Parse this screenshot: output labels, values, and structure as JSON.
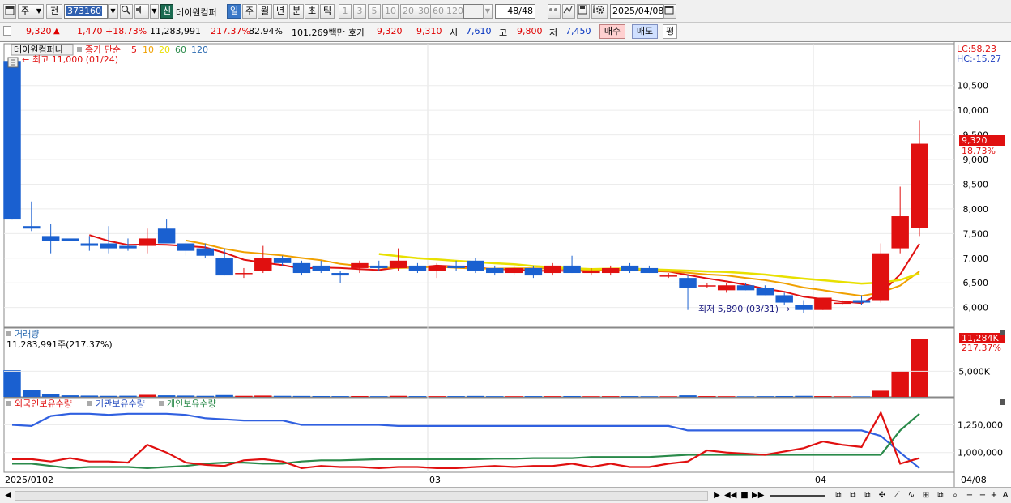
{
  "toolbar": {
    "period_select": "주",
    "prev_label": "전",
    "stock_code": "373160",
    "tag_label": "신",
    "stock_name": "데이원컴퍼",
    "periods": [
      "일",
      "주",
      "월",
      "년",
      "분",
      "초",
      "틱"
    ],
    "active_period": "일",
    "intervals": [
      "1",
      "3",
      "5",
      "10",
      "20",
      "30",
      "60",
      "120"
    ],
    "count": "48",
    "count_total": "/48",
    "date": "2025/04/08"
  },
  "quote": {
    "price": "9,320",
    "change": "1,470",
    "change_pct": "+18.73%",
    "volume": "11,283,991",
    "volume_pct": "217.37%",
    "rate": "82.94%",
    "amount": "101,269백만",
    "hoga_label": "호가",
    "ask": "9,320",
    "bid": "9,310",
    "open_label": "시",
    "open": "7,610",
    "high_label": "고",
    "high": "9,800",
    "low_label": "저",
    "low": "7,450",
    "buy_label": "매수",
    "sell_label": "매도",
    "flat_label": "평"
  },
  "price_pane": {
    "stock_title": "데이원컴퍼니",
    "indicator_name": "종가 단순",
    "ma_labels": [
      "5",
      "10",
      "20",
      "60",
      "120"
    ],
    "ma_colors": [
      "#e01010",
      "#f0a000",
      "#e8e000",
      "#2a8a4a",
      "#2a6ab0"
    ],
    "high_annotation": "최고 11,000 (01/24)",
    "low_annotation": "최저 5,890 (03/31)",
    "lc_label": "LC:58.23",
    "hc_label": "HC:-15.27",
    "current_price_tag": "9,320",
    "current_pct_tag": "18.73%"
  },
  "volume_pane": {
    "title": "거래량",
    "value": "11,283,991주(217.37%)",
    "tag": "11,284K",
    "tag_pct": "217.37%"
  },
  "holding_pane": {
    "series_names": [
      "외국인보유수량",
      "기관보유수량",
      "개인보유수량"
    ]
  },
  "x_axis": {
    "labels": [
      "2025/01",
      "02",
      "03",
      "04"
    ],
    "right_label": "04/08"
  },
  "chart_data": {
    "type": "candlestick",
    "price_axis": {
      "min": 5600,
      "max": 11300,
      "ticks": [
        6000,
        6500,
        7000,
        7500,
        8000,
        8500,
        9000,
        9500,
        10000,
        10500
      ],
      "tick_labels": [
        "6,000",
        "6,500",
        "7,000",
        "7,500",
        "8,000",
        "8,500",
        "9,000",
        "9,500",
        "10,000",
        "10,500"
      ]
    },
    "candles": [
      {
        "o": 11000,
        "h": 11000,
        "l": 7800,
        "c": 7800
      },
      {
        "o": 7650,
        "h": 8150,
        "l": 7550,
        "c": 7600
      },
      {
        "o": 7450,
        "h": 7700,
        "l": 7100,
        "c": 7350
      },
      {
        "o": 7400,
        "h": 7600,
        "l": 7250,
        "c": 7350
      },
      {
        "o": 7300,
        "h": 7450,
        "l": 7150,
        "c": 7250
      },
      {
        "o": 7300,
        "h": 7650,
        "l": 7100,
        "c": 7200
      },
      {
        "o": 7250,
        "h": 7400,
        "l": 7150,
        "c": 7200
      },
      {
        "o": 7250,
        "h": 7600,
        "l": 7100,
        "c": 7400
      },
      {
        "o": 7600,
        "h": 7800,
        "l": 7300,
        "c": 7300
      },
      {
        "o": 7300,
        "h": 7350,
        "l": 7050,
        "c": 7150
      },
      {
        "o": 7200,
        "h": 7300,
        "l": 7000,
        "c": 7050
      },
      {
        "o": 7000,
        "h": 7200,
        "l": 6650,
        "c": 6650
      },
      {
        "o": 6700,
        "h": 6800,
        "l": 6600,
        "c": 6700
      },
      {
        "o": 6750,
        "h": 7250,
        "l": 6700,
        "c": 7000
      },
      {
        "o": 7000,
        "h": 7050,
        "l": 6850,
        "c": 6900
      },
      {
        "o": 6900,
        "h": 6950,
        "l": 6650,
        "c": 6700
      },
      {
        "o": 6850,
        "h": 6950,
        "l": 6700,
        "c": 6750
      },
      {
        "o": 6700,
        "h": 6750,
        "l": 6500,
        "c": 6650
      },
      {
        "o": 6800,
        "h": 6950,
        "l": 6700,
        "c": 6900
      },
      {
        "o": 6850,
        "h": 6950,
        "l": 6750,
        "c": 6800
      },
      {
        "o": 6800,
        "h": 7200,
        "l": 6750,
        "c": 6950
      },
      {
        "o": 6850,
        "h": 6900,
        "l": 6700,
        "c": 6750
      },
      {
        "o": 6750,
        "h": 6900,
        "l": 6600,
        "c": 6850
      },
      {
        "o": 6850,
        "h": 6950,
        "l": 6750,
        "c": 6800
      },
      {
        "o": 6950,
        "h": 7000,
        "l": 6700,
        "c": 6750
      },
      {
        "o": 6800,
        "h": 6850,
        "l": 6650,
        "c": 6700
      },
      {
        "o": 6700,
        "h": 6850,
        "l": 6650,
        "c": 6800
      },
      {
        "o": 6800,
        "h": 6850,
        "l": 6600,
        "c": 6650
      },
      {
        "o": 6700,
        "h": 6900,
        "l": 6650,
        "c": 6850
      },
      {
        "o": 6850,
        "h": 7050,
        "l": 6700,
        "c": 6700
      },
      {
        "o": 6700,
        "h": 6800,
        "l": 6650,
        "c": 6750
      },
      {
        "o": 6700,
        "h": 6850,
        "l": 6650,
        "c": 6800
      },
      {
        "o": 6850,
        "h": 6900,
        "l": 6700,
        "c": 6750
      },
      {
        "o": 6800,
        "h": 6850,
        "l": 6700,
        "c": 6700
      },
      {
        "o": 6650,
        "h": 6700,
        "l": 6600,
        "c": 6650
      },
      {
        "o": 6600,
        "h": 6650,
        "l": 5950,
        "c": 6400
      },
      {
        "o": 6450,
        "h": 6500,
        "l": 6400,
        "c": 6450
      },
      {
        "o": 6350,
        "h": 6500,
        "l": 6300,
        "c": 6450
      },
      {
        "o": 6450,
        "h": 6500,
        "l": 6350,
        "c": 6350
      },
      {
        "o": 6400,
        "h": 6450,
        "l": 6250,
        "c": 6250
      },
      {
        "o": 6250,
        "h": 6300,
        "l": 6050,
        "c": 6100
      },
      {
        "o": 6050,
        "h": 6150,
        "l": 5890,
        "c": 5950
      },
      {
        "o": 5950,
        "h": 6200,
        "l": 5950,
        "c": 6200
      },
      {
        "o": 6100,
        "h": 6150,
        "l": 6050,
        "c": 6100
      },
      {
        "o": 6150,
        "h": 6250,
        "l": 6050,
        "c": 6100
      },
      {
        "o": 6150,
        "h": 7300,
        "l": 6100,
        "c": 7100
      },
      {
        "o": 7200,
        "h": 8450,
        "l": 7100,
        "c": 7850
      },
      {
        "o": 7610,
        "h": 9800,
        "l": 7450,
        "c": 9320
      }
    ],
    "volume_axis": {
      "ticks": [
        5000
      ],
      "tick_labels": [
        "5,000K"
      ],
      "max": 12000
    },
    "volume_k": [
      5200,
      1400,
      500,
      300,
      250,
      200,
      220,
      400,
      300,
      250,
      200,
      350,
      200,
      250,
      200,
      180,
      160,
      150,
      160,
      140,
      200,
      150,
      140,
      150,
      180,
      140,
      130,
      150,
      140,
      160,
      130,
      140,
      150,
      130,
      120,
      300,
      150,
      130,
      120,
      140,
      160,
      200,
      150,
      120,
      110,
      1200,
      5000,
      11284
    ],
    "holding_axis": {
      "ticks": [
        1000000,
        1250000
      ],
      "tick_labels": [
        "1,000,000",
        "1,250,000"
      ],
      "min": 830000,
      "max": 1400000
    },
    "foreign": [
      940000,
      940000,
      920000,
      950000,
      920000,
      920000,
      910000,
      1070000,
      1000000,
      910000,
      890000,
      880000,
      930000,
      940000,
      920000,
      860000,
      880000,
      870000,
      870000,
      860000,
      870000,
      870000,
      860000,
      860000,
      870000,
      880000,
      870000,
      880000,
      880000,
      900000,
      870000,
      900000,
      870000,
      870000,
      900000,
      920000,
      1020000,
      1000000,
      990000,
      980000,
      1010000,
      1040000,
      1100000,
      1070000,
      1050000,
      1360000,
      900000,
      950000
    ],
    "institution": [
      1250000,
      1240000,
      1330000,
      1350000,
      1350000,
      1340000,
      1350000,
      1350000,
      1350000,
      1340000,
      1310000,
      1300000,
      1290000,
      1290000,
      1290000,
      1250000,
      1250000,
      1250000,
      1250000,
      1250000,
      1240000,
      1240000,
      1240000,
      1240000,
      1240000,
      1240000,
      1240000,
      1240000,
      1240000,
      1240000,
      1240000,
      1240000,
      1240000,
      1240000,
      1240000,
      1200000,
      1200000,
      1200000,
      1200000,
      1200000,
      1200000,
      1200000,
      1200000,
      1200000,
      1200000,
      1150000,
      1000000,
      860000
    ],
    "individual": [
      900000,
      900000,
      880000,
      860000,
      870000,
      870000,
      870000,
      860000,
      870000,
      880000,
      900000,
      910000,
      910000,
      900000,
      900000,
      920000,
      930000,
      930000,
      935000,
      940000,
      940000,
      940000,
      940000,
      940000,
      940000,
      945000,
      945000,
      950000,
      950000,
      950000,
      960000,
      960000,
      960000,
      960000,
      970000,
      980000,
      980000,
      980000,
      980000,
      980000,
      980000,
      980000,
      980000,
      980000,
      980000,
      980000,
      1200000,
      1350000
    ]
  }
}
